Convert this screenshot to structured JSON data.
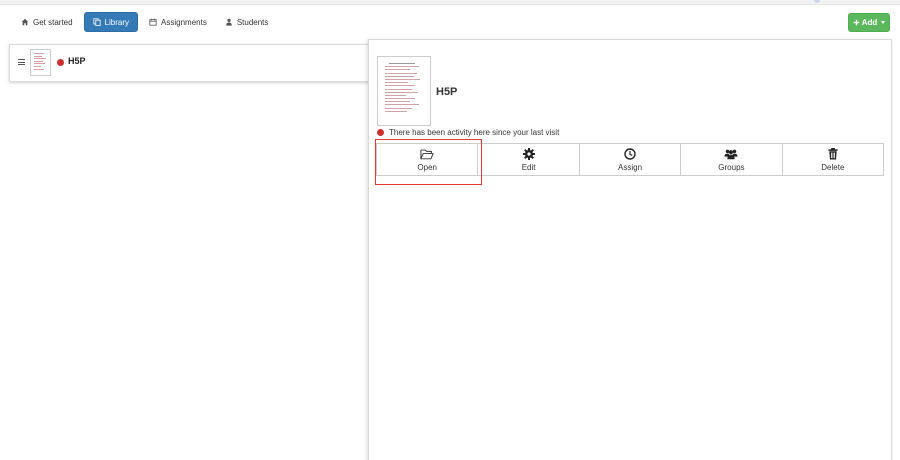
{
  "nav": {
    "items": [
      {
        "label": "Get started",
        "icon": "home-icon",
        "active": false
      },
      {
        "label": "Library",
        "icon": "copy-icon",
        "active": true
      },
      {
        "label": "Assignments",
        "icon": "calendar-icon",
        "active": false
      },
      {
        "label": "Students",
        "icon": "user-icon",
        "active": false
      }
    ]
  },
  "add_button": {
    "label": "Add",
    "icon": "plus-icon"
  },
  "list": {
    "items": [
      {
        "title": "H5P",
        "status_color": "#c9302c"
      }
    ]
  },
  "detail": {
    "title": "H5P",
    "activity_text": "There has been activity here since your last visit",
    "actions": [
      {
        "label": "Open",
        "icon": "folder-open-icon"
      },
      {
        "label": "Edit",
        "icon": "gear-icon"
      },
      {
        "label": "Assign",
        "icon": "clock-icon"
      },
      {
        "label": "Groups",
        "icon": "users-icon"
      },
      {
        "label": "Delete",
        "icon": "trash-icon"
      }
    ]
  },
  "colors": {
    "primary": "#337ab7",
    "success": "#5cb85c",
    "status_red": "#c9302c",
    "highlight": "#e53935"
  }
}
